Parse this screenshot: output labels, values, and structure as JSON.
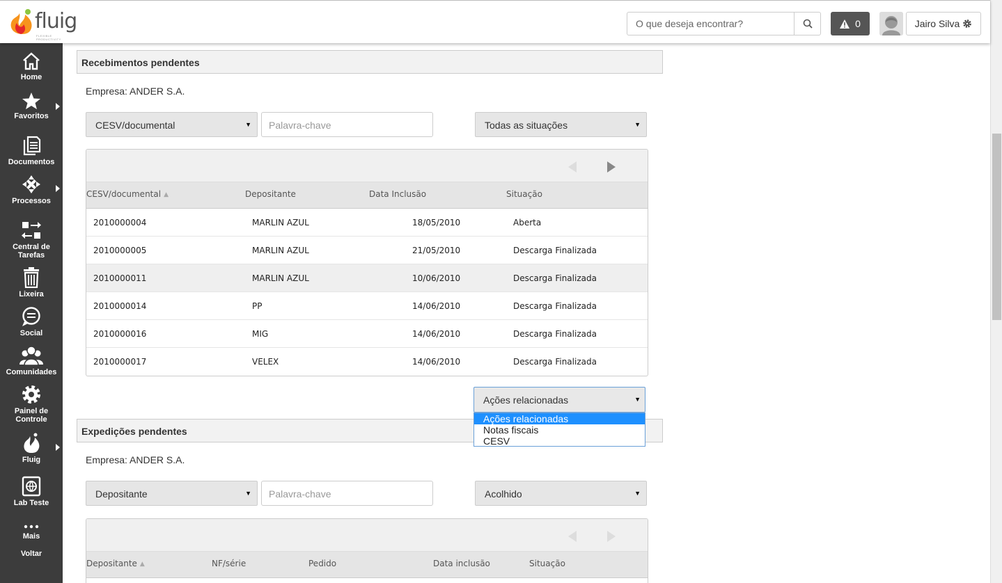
{
  "header": {
    "logo_text": "fluig",
    "logo_sub": "FLEXIBLE PRODUCTIVITY",
    "search_placeholder": "O que deseja encontrar?",
    "alert_count": "0",
    "user_name": "Jairo Silva"
  },
  "sidebar": {
    "items": [
      {
        "label": "Home",
        "icon": "home-icon"
      },
      {
        "label": "Favoritos",
        "icon": "star-icon"
      },
      {
        "label": "Documentos",
        "icon": "document-icon"
      },
      {
        "label": "Processos",
        "icon": "process-icon"
      },
      {
        "label": "Central de Tarefas",
        "icon": "tasks-icon"
      },
      {
        "label": "Lixeira",
        "icon": "trash-icon"
      },
      {
        "label": "Social",
        "icon": "chat-icon"
      },
      {
        "label": "Comunidades",
        "icon": "community-icon"
      },
      {
        "label": "Painel de Controle",
        "icon": "gear-icon"
      },
      {
        "label": "Fluig",
        "icon": "fluig-icon"
      },
      {
        "label": "Lab Teste",
        "icon": "lab-icon"
      },
      {
        "label": "Mais",
        "icon": "more-icon"
      },
      {
        "label": "Voltar",
        "icon": ""
      }
    ]
  },
  "receipts": {
    "title": "Recebimentos pendentes",
    "company": "Empresa: ANDER S.A.",
    "filter_field": "CESV/documental",
    "keyword_placeholder": "Palavra-chave",
    "status_filter": "Todas as situações",
    "columns": [
      "CESV/documental",
      "Depositante",
      "Data Inclusão",
      "Situação"
    ],
    "rows": [
      {
        "doc": "2010000004",
        "depositor": "MARLIN AZUL",
        "date": "18/05/2010",
        "status": "Aberta"
      },
      {
        "doc": "2010000005",
        "depositor": "MARLIN AZUL",
        "date": "21/05/2010",
        "status": "Descarga Finalizada"
      },
      {
        "doc": "2010000011",
        "depositor": "MARLIN AZUL",
        "date": "10/06/2010",
        "status": "Descarga Finalizada"
      },
      {
        "doc": "2010000014",
        "depositor": "PP",
        "date": "14/06/2010",
        "status": "Descarga Finalizada"
      },
      {
        "doc": "2010000016",
        "depositor": "MIG",
        "date": "14/06/2010",
        "status": "Descarga Finalizada"
      },
      {
        "doc": "2010000017",
        "depositor": "VELEX",
        "date": "14/06/2010",
        "status": "Descarga Finalizada"
      }
    ],
    "actions_label": "Ações relacionadas",
    "actions_options": [
      "Ações relacionadas",
      "Notas fiscais",
      "CESV"
    ]
  },
  "shipments": {
    "title": "Expedições pendentes",
    "company": "Empresa: ANDER S.A.",
    "filter_field": "Depositante",
    "keyword_placeholder": "Palavra-chave",
    "status_filter": "Acolhido",
    "columns": [
      "Depositante",
      "NF/série",
      "Pedido",
      "Data inclusão",
      "Situação"
    ]
  }
}
